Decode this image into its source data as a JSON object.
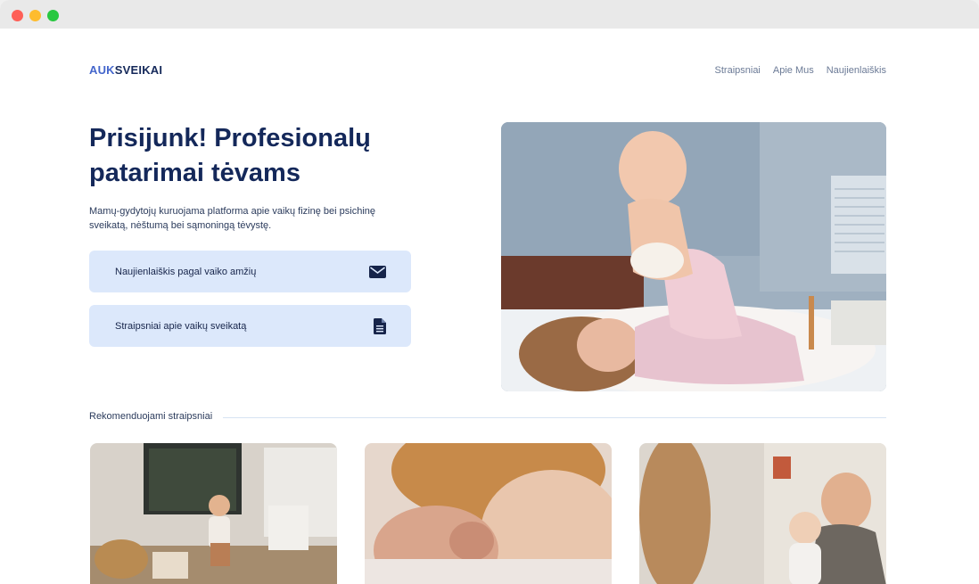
{
  "brand": {
    "part1": "AUK",
    "part2": "SVEIKAI"
  },
  "nav": {
    "items": [
      "Straipsniai",
      "Apie Mus",
      "Naujienlaiškis"
    ]
  },
  "hero": {
    "title": "Prisijunk! Profesionalų patarimai tėvams",
    "subtitle": "Mamų-gydytojų kuruojama platforma apie vaikų fizinę bei psichinę sveikatą, nėštumą bei sąmoningą tėvystę.",
    "cta": [
      {
        "label": "Naujienlaiškis pagal vaiko amžių",
        "icon": "envelope-icon"
      },
      {
        "label": "Straipsniai apie vaikų sveikatą",
        "icon": "document-icon"
      }
    ]
  },
  "recommended": {
    "label": "Rekomenduojami straipsniai"
  },
  "colors": {
    "accent": "#4466cc",
    "navy": "#14285a",
    "cta_bg": "#dce8fb"
  }
}
